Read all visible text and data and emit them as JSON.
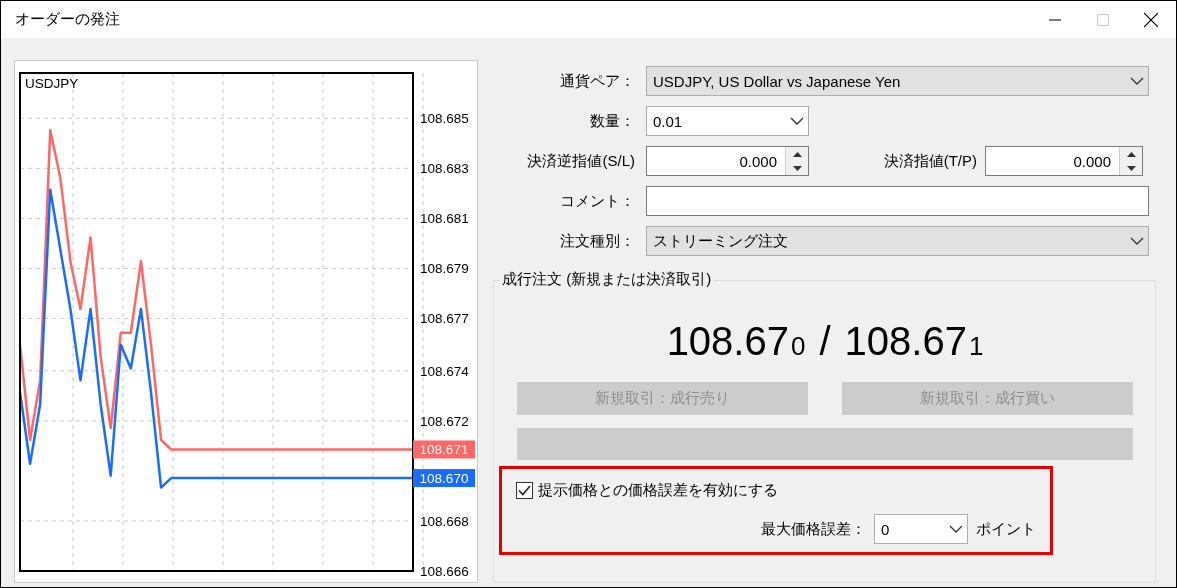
{
  "window": {
    "title": "オーダーの発注",
    "controls": [
      {
        "kind": "minimize",
        "disabled": false
      },
      {
        "kind": "maximize",
        "disabled": true
      },
      {
        "kind": "close",
        "disabled": false
      }
    ]
  },
  "chart": {
    "symbol": "USDJPY",
    "price_tags": [
      {
        "label": "108.671"
      },
      {
        "label": "108.670"
      }
    ],
    "chart_data": {
      "type": "line",
      "grid": true,
      "categories": [
        null,
        null,
        null,
        null,
        null,
        null,
        null,
        null,
        null,
        null,
        null,
        null,
        null,
        null,
        null,
        null,
        null,
        null,
        null,
        null,
        null,
        null,
        null,
        null,
        null,
        null,
        null,
        null,
        null,
        null,
        null,
        null,
        null,
        null,
        null,
        null,
        null,
        null,
        null,
        null
      ],
      "ylim": [
        108.666,
        108.6869
      ],
      "yticks": [
        {
          "value": 108.685,
          "label": "108.685"
        },
        {
          "value": 108.6829,
          "label": "108.683"
        },
        {
          "value": 108.6808,
          "label": "108.681"
        },
        {
          "value": 108.6787,
          "label": "108.679"
        },
        {
          "value": 108.6766,
          "label": "108.677"
        },
        {
          "value": 108.6744,
          "label": "108.674"
        },
        {
          "value": 108.6723,
          "label": "108.672"
        },
        {
          "value": 108.6681,
          "label": "108.668"
        },
        {
          "value": 108.666,
          "label": "108.666"
        }
      ],
      "series": [
        {
          "color": "#ff6666",
          "values": [
            108.6755,
            108.6715,
            108.674,
            108.6845,
            108.6825,
            108.679,
            108.677,
            108.68,
            108.675,
            108.672,
            108.676,
            108.676,
            108.679,
            108.6755,
            108.6715,
            108.6711,
            108.6711,
            108.6711,
            108.6711,
            108.6711,
            108.6711,
            108.6711,
            108.6711,
            108.6711,
            108.6711,
            108.6711,
            108.6711,
            108.6711,
            108.6711,
            108.6711,
            108.6711,
            108.6711,
            108.6711,
            108.6711,
            108.6711,
            108.6711,
            108.6711,
            108.6711,
            108.6711,
            108.6711
          ]
        },
        {
          "color": "#1a6cff",
          "values": [
            108.6735,
            108.6705,
            108.673,
            108.682,
            108.6795,
            108.677,
            108.674,
            108.677,
            108.673,
            108.67,
            108.6755,
            108.6745,
            108.677,
            108.6735,
            108.6695,
            108.6699,
            108.6699,
            108.6699,
            108.6699,
            108.6699,
            108.6699,
            108.6699,
            108.6699,
            108.6699,
            108.6699,
            108.6699,
            108.6699,
            108.6699,
            108.6699,
            108.6699,
            108.6699,
            108.6699,
            108.6699,
            108.6699,
            108.6699,
            108.6699,
            108.6699,
            108.6699,
            108.6699,
            108.6699
          ]
        }
      ]
    }
  },
  "form": {
    "symbol": {
      "label": "通貨ペア：",
      "value": "USDJPY, US Dollar vs Japanese Yen"
    },
    "volume": {
      "label": "数量：",
      "value": "0.01"
    },
    "stop_loss": {
      "label": "決済逆指値(S/L)",
      "value": "0.000"
    },
    "take_profit": {
      "label": "決済指値(T/P)",
      "value": "0.000"
    },
    "comment": {
      "label": "コメント："
    },
    "order_type": {
      "label": "注文種別：",
      "value": "ストリーミング注文"
    }
  },
  "market_order": {
    "title": "成行注文 (新規または決済取引)",
    "bid": "108.67",
    "bid_pip": "0",
    "separator": "/",
    "ask": "108.67",
    "ask_pip": "1",
    "buttons": [
      {
        "label": "新規取引：成行売り",
        "disabled": true
      },
      {
        "label": "新規取引：成行買い",
        "disabled": true
      }
    ],
    "deviation": {
      "highlighted": true,
      "checkbox": {
        "label": "提示価格との価格誤差を有効にする",
        "checked": true
      },
      "max_label": "最大価格誤差：",
      "max_value": "0",
      "unit": "ポイント"
    }
  }
}
